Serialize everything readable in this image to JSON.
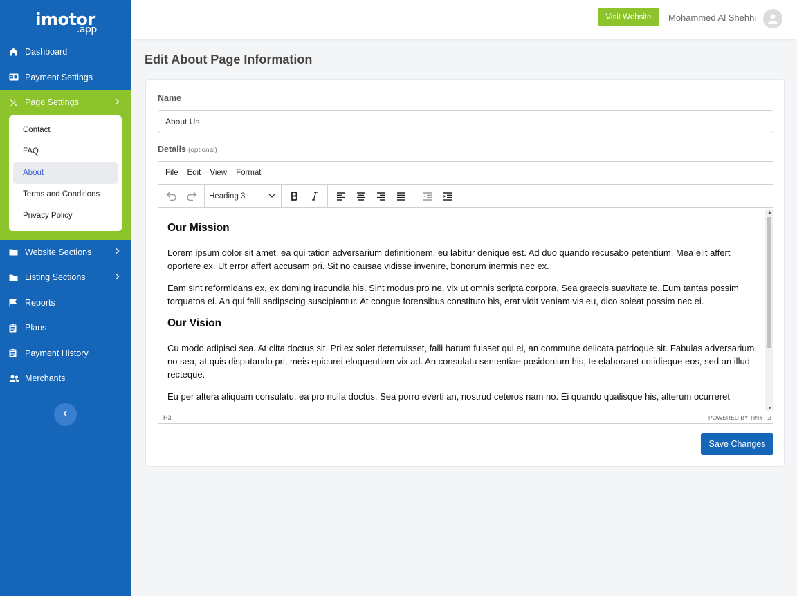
{
  "brand": {
    "logo_main": "imotor",
    "logo_sub": ".app"
  },
  "sidebar": {
    "items": [
      {
        "label": "Dashboard",
        "icon": "home-icon"
      },
      {
        "label": "Payment Settings",
        "icon": "card-icon"
      },
      {
        "label": "Page Settings",
        "icon": "tools-icon"
      },
      {
        "label": "Website Sections",
        "icon": "folder-icon"
      },
      {
        "label": "Listing Sections",
        "icon": "folder-icon"
      },
      {
        "label": "Reports",
        "icon": "flag-icon"
      },
      {
        "label": "Plans",
        "icon": "clipboard-icon"
      },
      {
        "label": "Payment History",
        "icon": "clipboard-icon"
      },
      {
        "label": "Merchants",
        "icon": "users-icon"
      }
    ],
    "page_settings_submenu": [
      "Contact",
      "FAQ",
      "About",
      "Terms and Conditions",
      "Privacy Policy"
    ],
    "active_submenu": "About"
  },
  "header": {
    "visit_label": "Visit Website",
    "user_name": "Mohammed Al Shehhi"
  },
  "main": {
    "title": "Edit About Page Information",
    "name_label": "Name",
    "name_value": "About Us",
    "details_label": "Details",
    "details_optional": "(optional)",
    "save_label": "Save Changes"
  },
  "editor": {
    "menus": [
      "File",
      "Edit",
      "View",
      "Format"
    ],
    "block_format": "Heading 3",
    "status_path": "H3",
    "powered_by": "POWERED BY TINY",
    "content": {
      "h1": "Our Mission",
      "p1": "Lorem ipsum dolor sit amet, ea qui tation adversarium definitionem, eu labitur denique est. Ad duo quando recusabo petentium. Mea elit affert oportere ex. Ut error affert accusam pri. Sit no causae vidisse invenire, bonorum inermis nec ex.",
      "p2": "Eam sint reformidans ex, ex doming iracundia his. Sint modus pro ne, vix ut omnis scripta corpora. Sea graecis suavitate te. Eum tantas possim torquatos ei. An qui falli sadipscing suscipiantur. At congue forensibus constituto his, erat vidit veniam vis eu, dico soleat possim nec ei.",
      "h2": "Our Vision",
      "p3": "Cu modo adipisci sea. At clita doctus sit. Pri ex solet deterruisset, falli harum fuisset qui ei, an commune delicata patrioque sit. Fabulas adversarium no sea, at quis disputando pri, meis epicurei eloquentiam vix ad. An consulatu sententiae posidonium his, te elaboraret cotidieque eos, sed an illud recteque.",
      "p4": "Eu per altera aliquam consulatu, ea pro nulla doctus. Sea porro everti an, nostrud ceteros nam no. Ei quando qualisque his, alterum ocurreret"
    }
  },
  "colors": {
    "sidebar": "#1565b8",
    "accent_green": "#8dc42c",
    "primary_button": "#1565b8"
  }
}
